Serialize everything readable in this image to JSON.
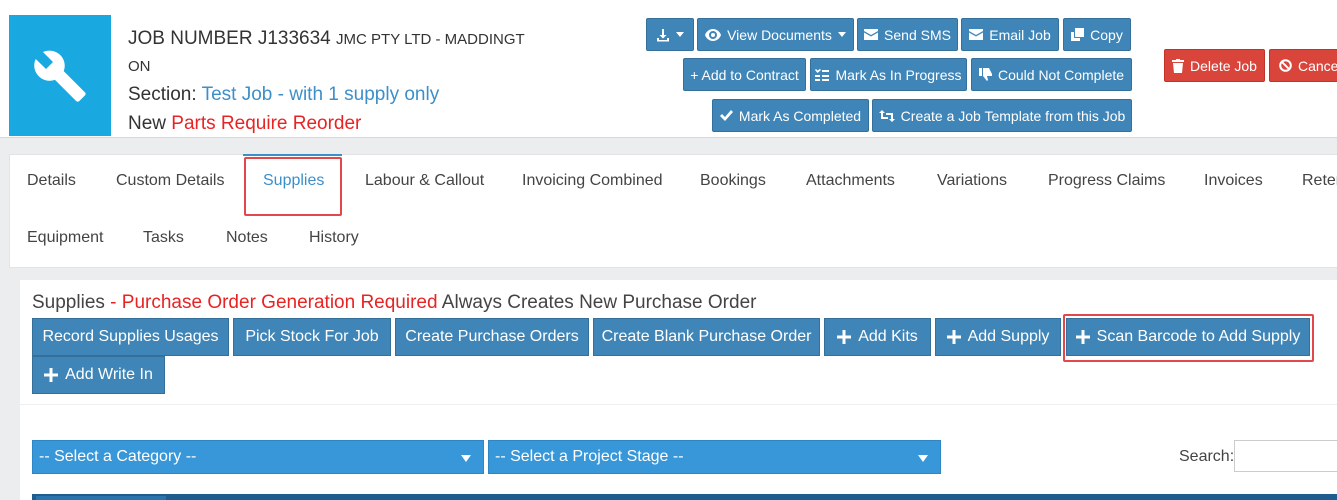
{
  "header": {
    "job_number": "JOB NUMBER J133634",
    "company": "JMC PTY LTD - MADDINGT",
    "company_cont": "ON",
    "section_label": "Section:",
    "section_value": "Test Job - with 1 supply only",
    "status_label": "New",
    "status_value": "Parts Require Reorder"
  },
  "actions": {
    "view_documents": "View Documents",
    "send_sms": "Send SMS",
    "email_job": "Email Job",
    "copy": "Copy",
    "add_to_contract": "+ Add to Contract",
    "mark_in_progress": "Mark As In Progress",
    "could_not_complete": "Could Not Complete",
    "mark_completed": "Mark As Completed",
    "create_template": "Create a Job Template from this Job",
    "delete_job": "Delete Job",
    "cancel": "Cancel"
  },
  "tabs": [
    {
      "label": "Details"
    },
    {
      "label": "Custom Details"
    },
    {
      "label": "Supplies"
    },
    {
      "label": "Labour & Callout"
    },
    {
      "label": "Invoicing Combined"
    },
    {
      "label": "Bookings"
    },
    {
      "label": "Attachments"
    },
    {
      "label": "Variations"
    },
    {
      "label": "Progress Claims"
    },
    {
      "label": "Invoices"
    },
    {
      "label": "Reten"
    },
    {
      "label": "Equipment"
    },
    {
      "label": "Tasks"
    },
    {
      "label": "Notes"
    },
    {
      "label": "History"
    }
  ],
  "supplies": {
    "title": "Supplies",
    "warning": "- Purchase Order Generation Required",
    "note": "Always Creates New Purchase Order",
    "buttons": {
      "record_usages": "Record Supplies Usages",
      "pick_stock": "Pick Stock For Job",
      "create_pos": "Create Purchase Orders",
      "create_blank_po": "Create Blank Purchase Order",
      "add_kits": "Add Kits",
      "add_supply": "Add Supply",
      "scan_barcode": "Scan Barcode to Add Supply",
      "add_write_in": "Add Write In"
    },
    "category_select": "-- Select a Category --",
    "stage_select": "-- Select a Project Stage --",
    "search_label": "Search:"
  },
  "colors": {
    "primary": "#3f85b7",
    "danger": "#d9453b",
    "select": "#3897d8",
    "highlight": "#e2474b",
    "link": "#3d8fc9",
    "alert_text": "#e82323"
  }
}
